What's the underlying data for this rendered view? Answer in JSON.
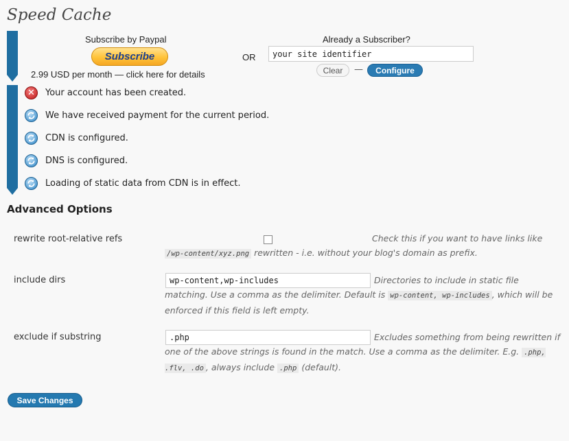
{
  "page": {
    "title": "Speed Cache"
  },
  "subscribe": {
    "label": "Subscribe by Paypal",
    "button_label": "Subscribe",
    "price_text": "2.99 USD per month — click here for details",
    "or_text": "OR"
  },
  "subscriber": {
    "label": "Already a Subscriber?",
    "identifier_value": "your site identifier",
    "clear_label": "Clear",
    "dash": "—",
    "configure_label": "Configure"
  },
  "statuses": [
    {
      "icon": "error-icon",
      "text": "Your account has been created."
    },
    {
      "icon": "refresh-icon",
      "text": "We have received payment for the current period."
    },
    {
      "icon": "refresh-icon",
      "text": "CDN is configured."
    },
    {
      "icon": "refresh-icon",
      "text": "DNS is configured."
    },
    {
      "icon": "refresh-icon",
      "text": "Loading of static data from CDN is in effect."
    }
  ],
  "advanced": {
    "heading": "Advanced Options",
    "rewrite": {
      "label": "rewrite root-relative refs",
      "checked": false,
      "desc_1": "Check this if you want to have links like",
      "code_1": "/wp-content/xyz.png",
      "desc_2": "rewritten - i.e. without your blog's domain as prefix."
    },
    "include": {
      "label": "include dirs",
      "value": "wp-content,wp-includes",
      "desc_1": "Directories to include in static file matching. Use a comma as the delimiter. Default is",
      "code_1": "wp-content, wp-includes",
      "desc_2": ", which will be enforced if this field is left empty."
    },
    "exclude": {
      "label": "exclude if substring",
      "value": ".php",
      "desc_1": "Excludes something from being rewritten if one of the above strings is found in the match. Use a comma as the delimiter. E.g.",
      "code_1": ".php, .flv, .do",
      "desc_2": ", always include",
      "code_2": ".php",
      "desc_3": "(default)."
    }
  },
  "save_label": "Save Changes",
  "colors": {
    "accent": "#1f6ea1",
    "button_blue": "#2479b0",
    "paypal_gold": "#ffc339",
    "error_red": "#c01818"
  }
}
